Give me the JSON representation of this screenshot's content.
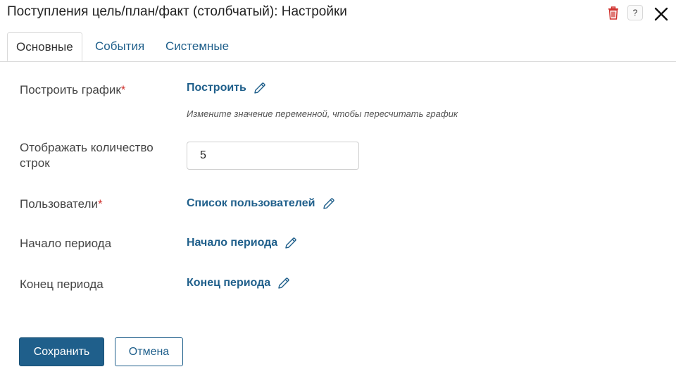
{
  "dialog": {
    "title": "Поступления цель/план/факт (столбчатый): Настройки",
    "icons": {
      "trash": "trash-icon",
      "help": "help-icon",
      "help_glyph": "?",
      "close": "close-icon"
    }
  },
  "tabs": [
    {
      "label": "Основные",
      "active": true
    },
    {
      "label": "События",
      "active": false
    },
    {
      "label": "Системные",
      "active": false
    }
  ],
  "form": {
    "build_chart": {
      "label": "Построить график",
      "required_mark": "*",
      "value": "Построить",
      "hint": "Измените значение переменной, чтобы пересчитать график"
    },
    "rows_count": {
      "label_line1": "Отображать количество",
      "label_line2": "строк",
      "value": "5"
    },
    "users": {
      "label": "Пользователи",
      "required_mark": "*",
      "value": "Список пользователей"
    },
    "period_start": {
      "label": "Начало периода",
      "value": "Начало периода"
    },
    "period_end": {
      "label": "Конец периода",
      "value": "Конец периода"
    }
  },
  "footer": {
    "save_label": "Сохранить",
    "cancel_label": "Отмена"
  },
  "colors": {
    "accent": "#1f5f8b",
    "required": "#d0312d",
    "trash": "#d0312d"
  }
}
